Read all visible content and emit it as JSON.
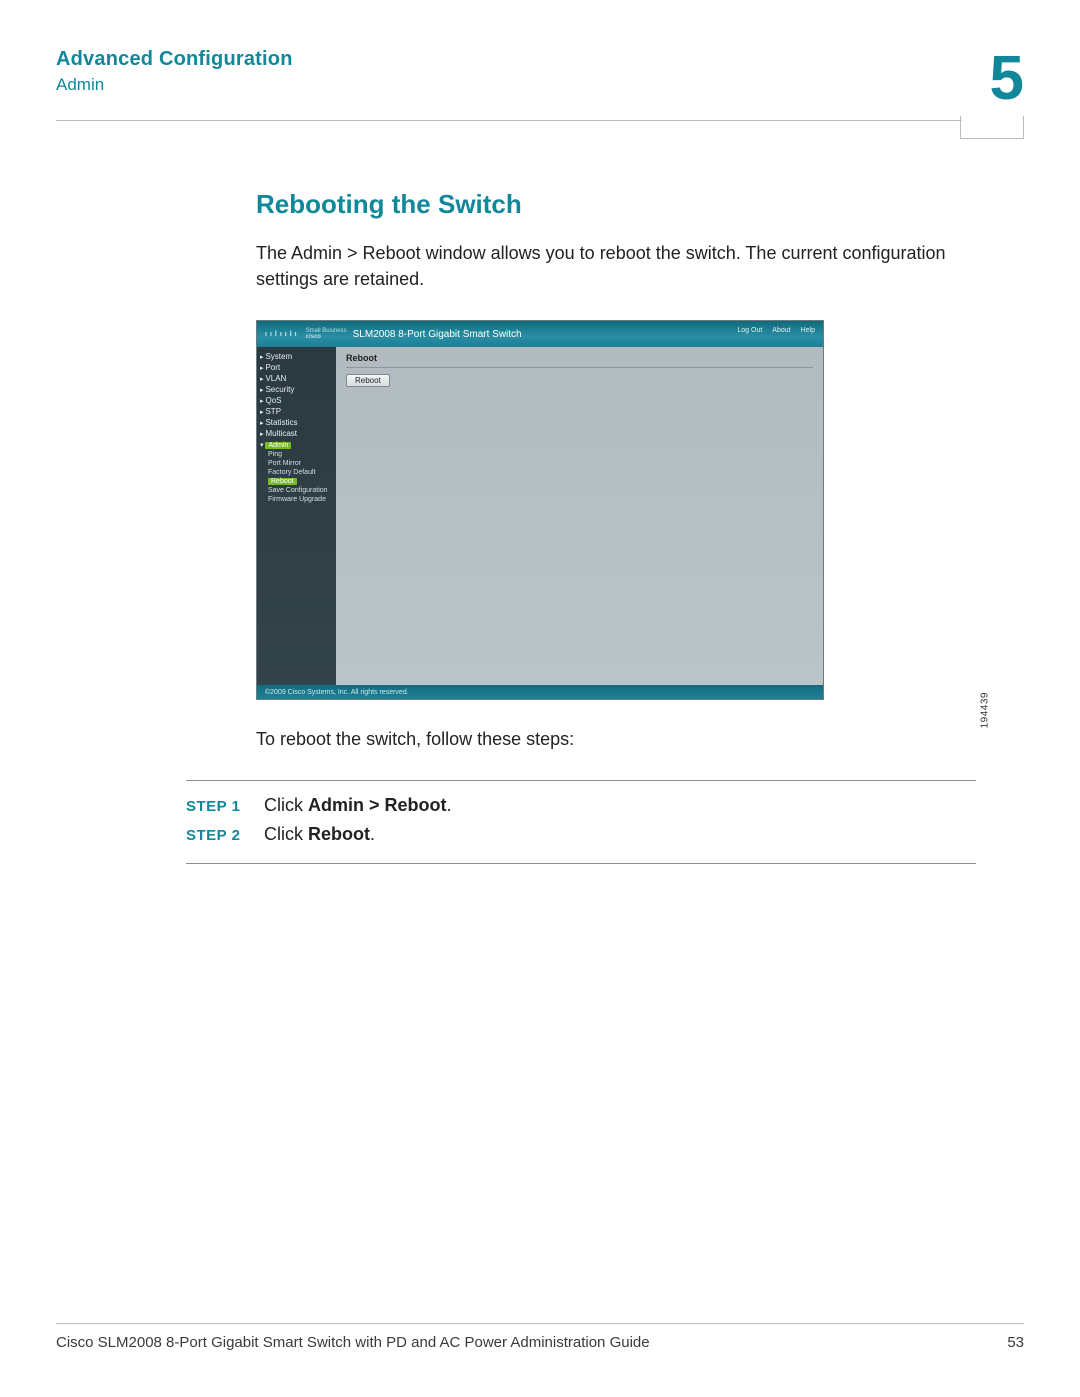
{
  "header": {
    "chapter_title": "Advanced Configuration",
    "breadcrumb": "Admin",
    "chapter_number": "5"
  },
  "section": {
    "title": "Rebooting the Switch",
    "intro": "The Admin > Reboot window allows you to reboot the switch. The current configuration settings are retained.",
    "post_image": "To reboot the switch, follow these steps:"
  },
  "screenshot": {
    "brand_small": "Small Business",
    "brand_logo": "cisco",
    "product": "SLM2008 8-Port Gigabit Smart Switch",
    "top_links": {
      "logout": "Log Out",
      "about": "About",
      "help": "Help"
    },
    "nav": {
      "items": [
        "System",
        "Port",
        "VLAN",
        "Security",
        "QoS",
        "STP",
        "Statistics",
        "Multicast"
      ],
      "admin_label": "Admin",
      "admin_children": [
        "Ping",
        "Port Mirror",
        "Factory Default"
      ],
      "reboot_label": "Reboot",
      "admin_rest": [
        "Save Configuration",
        "Firmware Upgrade"
      ]
    },
    "panel_title": "Reboot",
    "button": "Reboot",
    "copyright": "©2009 Cisco Systems, Inc. All rights reserved.",
    "image_id": "194439"
  },
  "steps": [
    {
      "label": "STEP 1",
      "prefix": "Click ",
      "bold": "Admin > Reboot",
      "suffix": "."
    },
    {
      "label": "STEP 2",
      "prefix": "Click ",
      "bold": "Reboot",
      "suffix": "."
    }
  ],
  "footer": {
    "doc_title": "Cisco SLM2008 8-Port Gigabit Smart Switch with PD and AC Power Administration Guide",
    "page_number": "53"
  }
}
